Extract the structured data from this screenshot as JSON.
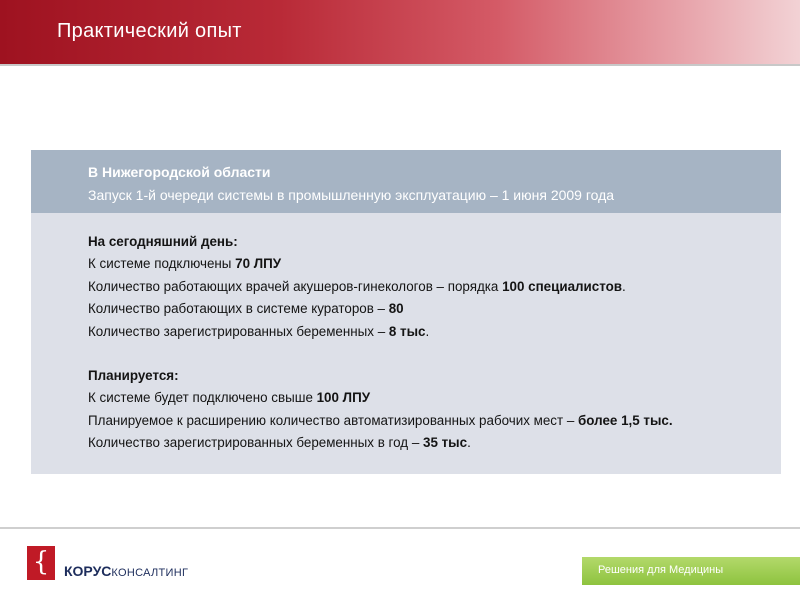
{
  "header": {
    "title": "Практический опыт"
  },
  "panel": {
    "region": "В Нижегородской области",
    "launch": "Запуск 1-й очереди системы в промышленную эксплуатацию –  1 июня 2009 года",
    "today": {
      "heading": "На сегодняшний день:",
      "lpu_prefix": "К системе подключены ",
      "lpu_value": "70 ЛПУ",
      "doctors_prefix": "Количество работающих врачей акушеров-гинекологов – порядка ",
      "doctors_value": "100 специалистов",
      "doctors_suffix": ".",
      "curators_prefix": "Количество работающих в системе кураторов – ",
      "curators_value": "80",
      "pregnant_prefix": "Количество зарегистрированных беременных – ",
      "pregnant_value": "8 тыс",
      "pregnant_suffix": "."
    },
    "planned": {
      "heading": "Планируется:",
      "lpu_prefix": "К системе будет подключено свыше ",
      "lpu_value": "100 ЛПУ",
      "workplaces_prefix": "Планируемое к расширению количество автоматизированных рабочих мест –  ",
      "workplaces_value": "более 1,5 тыс.",
      "pregnant_prefix": "Количество зарегистрированных беременных в год – ",
      "pregnant_value": "35 тыс",
      "pregnant_suffix": "."
    }
  },
  "footer": {
    "logo_symbol": "{",
    "logo_korus": "КОРУС",
    "logo_konsalting": "КОНСАЛТИНГ",
    "badge": "Решения для Медицины"
  }
}
